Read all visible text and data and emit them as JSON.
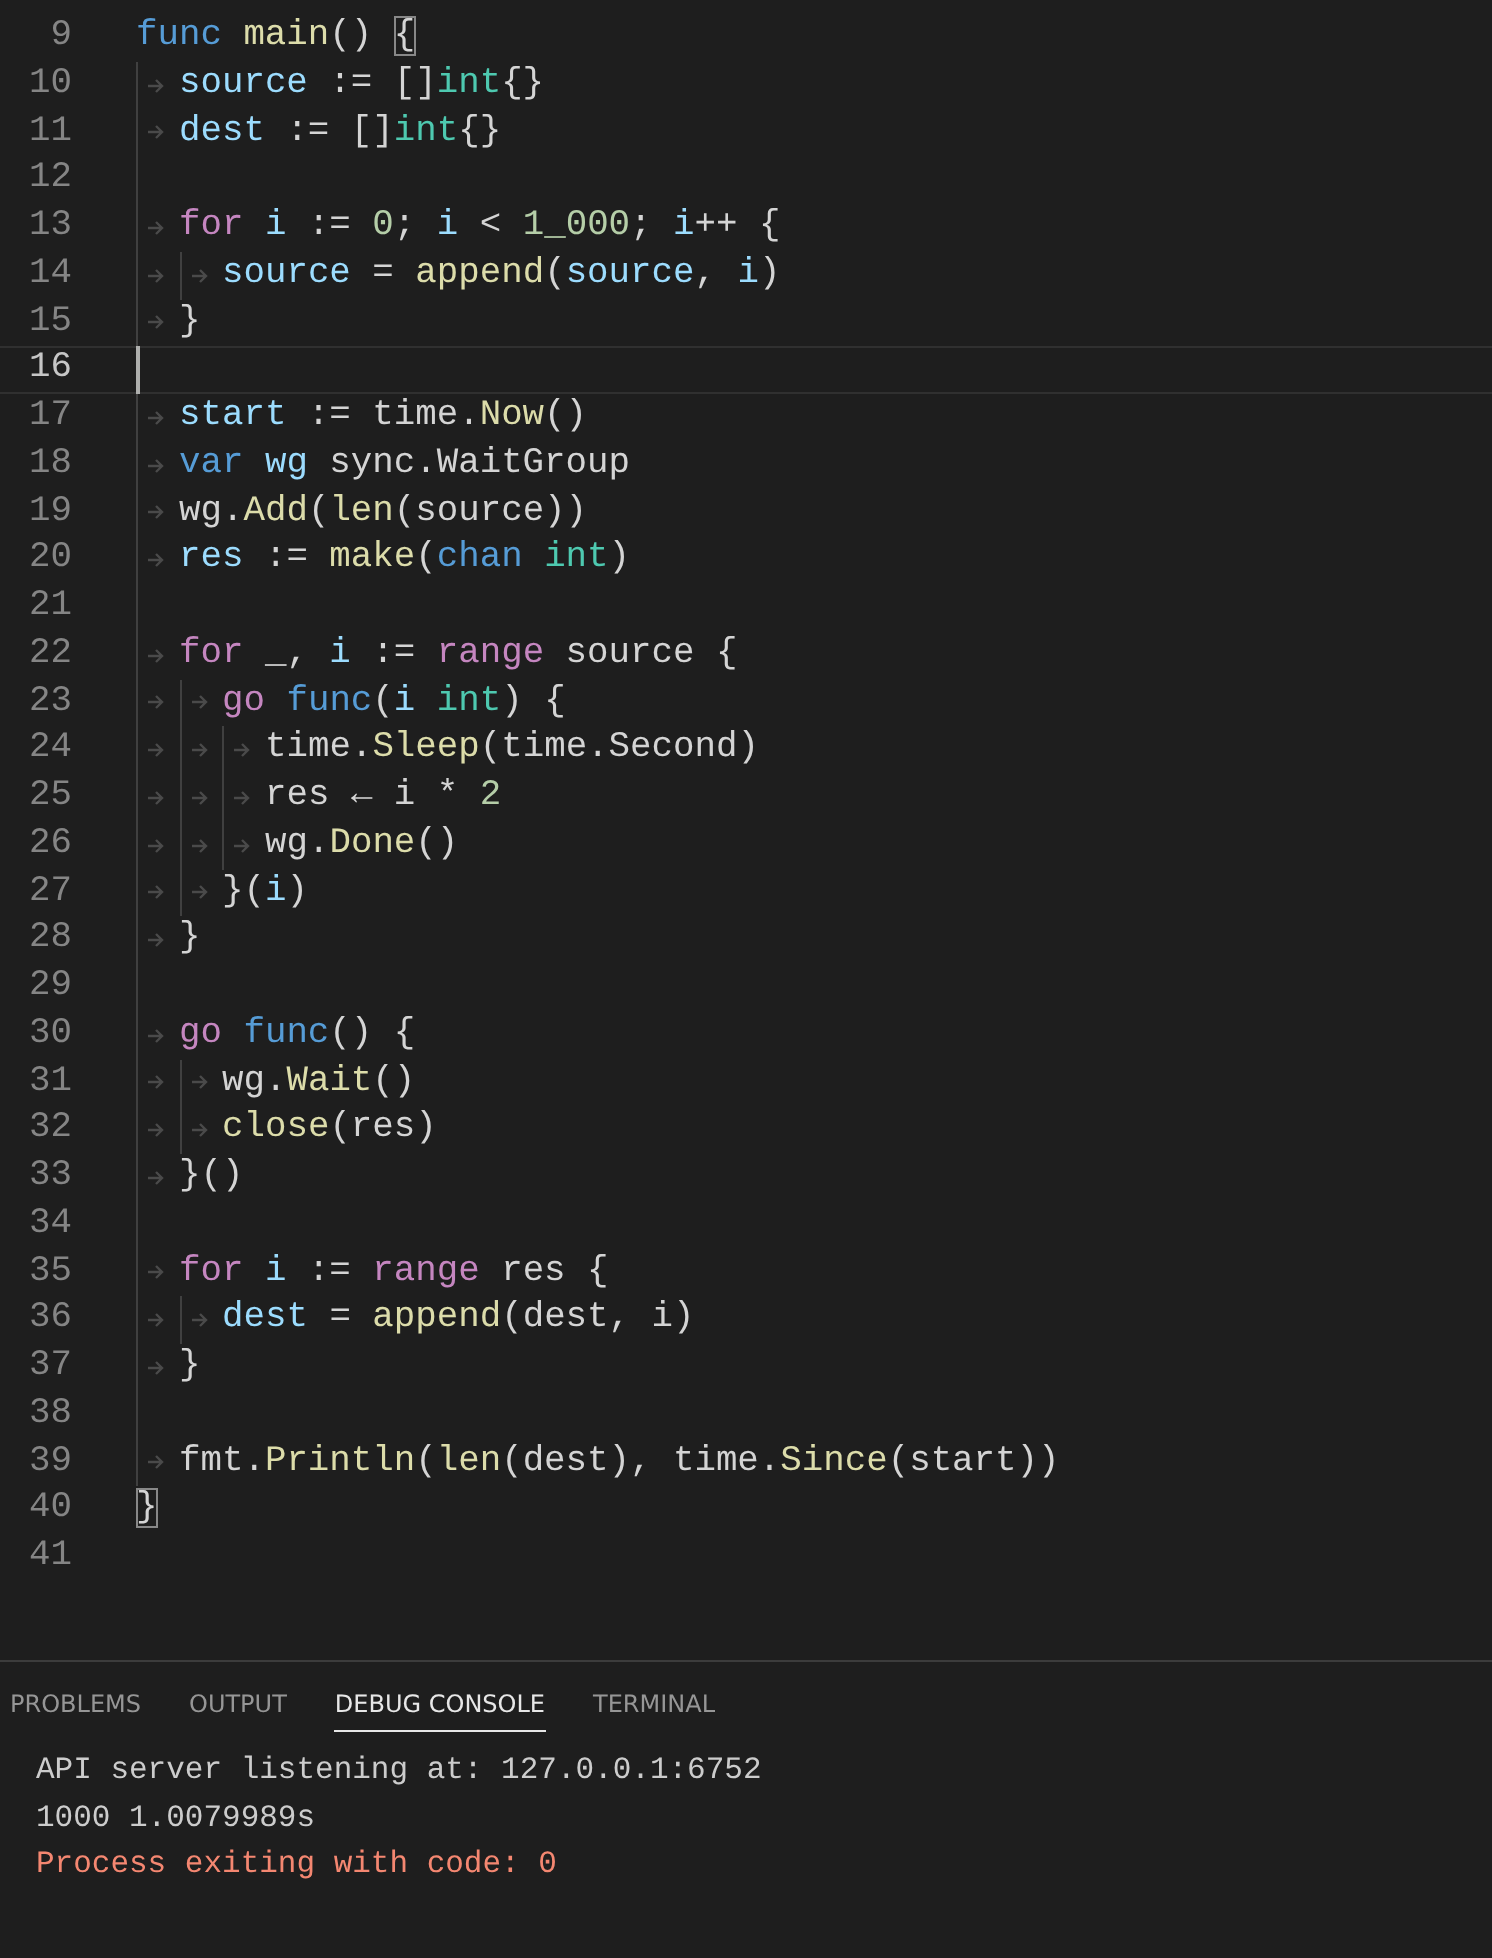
{
  "editor": {
    "lines": [
      {
        "number": "9",
        "current": false,
        "tokens": [
          {
            "text": "func ",
            "kind": "keyword"
          },
          {
            "text": "main",
            "kind": "function"
          },
          {
            "text": "() ",
            "kind": "plain"
          },
          {
            "text": "{",
            "kind": "bracket-match"
          }
        ]
      },
      {
        "number": "10",
        "current": false,
        "indent": [
          {
            "kind": "tab"
          }
        ],
        "tokens": [
          {
            "text": "source",
            "kind": "variable"
          },
          {
            "text": " := []",
            "kind": "plain"
          },
          {
            "text": "int",
            "kind": "type"
          },
          {
            "text": "{}",
            "kind": "plain"
          }
        ]
      },
      {
        "number": "11",
        "current": false,
        "indent": [
          {
            "kind": "tab"
          }
        ],
        "tokens": [
          {
            "text": "dest",
            "kind": "variable"
          },
          {
            "text": " := []",
            "kind": "plain"
          },
          {
            "text": "int",
            "kind": "type"
          },
          {
            "text": "{}",
            "kind": "plain"
          }
        ]
      },
      {
        "number": "12",
        "current": false,
        "indent": [
          {
            "kind": "guide"
          }
        ]
      },
      {
        "number": "13",
        "current": false,
        "indent": [
          {
            "kind": "tab"
          }
        ],
        "tokens": [
          {
            "text": "for ",
            "kind": "control"
          },
          {
            "text": "i",
            "kind": "variable"
          },
          {
            "text": " := ",
            "kind": "plain"
          },
          {
            "text": "0",
            "kind": "number"
          },
          {
            "text": "; ",
            "kind": "plain"
          },
          {
            "text": "i",
            "kind": "variable"
          },
          {
            "text": " < ",
            "kind": "plain"
          },
          {
            "text": "1_000",
            "kind": "number"
          },
          {
            "text": "; ",
            "kind": "plain"
          },
          {
            "text": "i",
            "kind": "variable"
          },
          {
            "text": "++ {",
            "kind": "plain"
          }
        ]
      },
      {
        "number": "14",
        "current": false,
        "indent": [
          {
            "kind": "tab"
          },
          {
            "kind": "tab"
          }
        ],
        "tokens": [
          {
            "text": "source",
            "kind": "variable"
          },
          {
            "text": " = ",
            "kind": "plain"
          },
          {
            "text": "append",
            "kind": "function"
          },
          {
            "text": "(",
            "kind": "plain"
          },
          {
            "text": "source",
            "kind": "variable"
          },
          {
            "text": ", ",
            "kind": "plain"
          },
          {
            "text": "i",
            "kind": "variable"
          },
          {
            "text": ")",
            "kind": "plain"
          }
        ]
      },
      {
        "number": "15",
        "current": false,
        "indent": [
          {
            "kind": "tab"
          }
        ],
        "tokens": [
          {
            "text": "}",
            "kind": "plain"
          }
        ]
      },
      {
        "number": "16",
        "current": true,
        "indent": [
          {
            "kind": "guide"
          }
        ]
      },
      {
        "number": "17",
        "current": false,
        "indent": [
          {
            "kind": "tab"
          }
        ],
        "tokens": [
          {
            "text": "start",
            "kind": "variable"
          },
          {
            "text": " := time.",
            "kind": "plain"
          },
          {
            "text": "Now",
            "kind": "function"
          },
          {
            "text": "()",
            "kind": "plain"
          }
        ]
      },
      {
        "number": "18",
        "current": false,
        "indent": [
          {
            "kind": "tab"
          }
        ],
        "tokens": [
          {
            "text": "var ",
            "kind": "keyword"
          },
          {
            "text": "wg",
            "kind": "variable"
          },
          {
            "text": " sync.WaitGroup",
            "kind": "plain"
          }
        ]
      },
      {
        "number": "19",
        "current": false,
        "indent": [
          {
            "kind": "tab"
          }
        ],
        "tokens": [
          {
            "text": "wg.",
            "kind": "plain"
          },
          {
            "text": "Add",
            "kind": "function"
          },
          {
            "text": "(",
            "kind": "plain"
          },
          {
            "text": "len",
            "kind": "function"
          },
          {
            "text": "(source))",
            "kind": "plain"
          }
        ]
      },
      {
        "number": "20",
        "current": false,
        "indent": [
          {
            "kind": "tab"
          }
        ],
        "tokens": [
          {
            "text": "res",
            "kind": "variable"
          },
          {
            "text": " := ",
            "kind": "plain"
          },
          {
            "text": "make",
            "kind": "function"
          },
          {
            "text": "(",
            "kind": "plain"
          },
          {
            "text": "chan ",
            "kind": "keyword"
          },
          {
            "text": "int",
            "kind": "type"
          },
          {
            "text": ")",
            "kind": "plain"
          }
        ]
      },
      {
        "number": "21",
        "current": false,
        "indent": [
          {
            "kind": "guide"
          }
        ]
      },
      {
        "number": "22",
        "current": false,
        "indent": [
          {
            "kind": "tab"
          }
        ],
        "tokens": [
          {
            "text": "for",
            "kind": "control"
          },
          {
            "text": " _, ",
            "kind": "plain"
          },
          {
            "text": "i",
            "kind": "variable"
          },
          {
            "text": " := ",
            "kind": "plain"
          },
          {
            "text": "range",
            "kind": "control"
          },
          {
            "text": " source {",
            "kind": "plain"
          }
        ]
      },
      {
        "number": "23",
        "current": false,
        "indent": [
          {
            "kind": "tab"
          },
          {
            "kind": "tab"
          }
        ],
        "tokens": [
          {
            "text": "go ",
            "kind": "control"
          },
          {
            "text": "func",
            "kind": "keyword"
          },
          {
            "text": "(",
            "kind": "plain"
          },
          {
            "text": "i ",
            "kind": "variable"
          },
          {
            "text": "int",
            "kind": "type"
          },
          {
            "text": ") {",
            "kind": "plain"
          }
        ]
      },
      {
        "number": "24",
        "current": false,
        "indent": [
          {
            "kind": "tab"
          },
          {
            "kind": "tab"
          },
          {
            "kind": "tab"
          }
        ],
        "tokens": [
          {
            "text": "time.",
            "kind": "plain"
          },
          {
            "text": "Sleep",
            "kind": "function"
          },
          {
            "text": "(time.Second)",
            "kind": "plain"
          }
        ]
      },
      {
        "number": "25",
        "current": false,
        "indent": [
          {
            "kind": "tab"
          },
          {
            "kind": "tab"
          },
          {
            "kind": "tab"
          }
        ],
        "tokens": [
          {
            "text": "res ← i * ",
            "kind": "plain"
          },
          {
            "text": "2",
            "kind": "number"
          }
        ]
      },
      {
        "number": "26",
        "current": false,
        "indent": [
          {
            "kind": "tab"
          },
          {
            "kind": "tab"
          },
          {
            "kind": "tab"
          }
        ],
        "tokens": [
          {
            "text": "wg.",
            "kind": "plain"
          },
          {
            "text": "Done",
            "kind": "function"
          },
          {
            "text": "()",
            "kind": "plain"
          }
        ]
      },
      {
        "number": "27",
        "current": false,
        "indent": [
          {
            "kind": "tab"
          },
          {
            "kind": "tab"
          }
        ],
        "tokens": [
          {
            "text": "}(",
            "kind": "plain"
          },
          {
            "text": "i",
            "kind": "variable"
          },
          {
            "text": ")",
            "kind": "plain"
          }
        ]
      },
      {
        "number": "28",
        "current": false,
        "indent": [
          {
            "kind": "tab"
          }
        ],
        "tokens": [
          {
            "text": "}",
            "kind": "plain"
          }
        ]
      },
      {
        "number": "29",
        "current": false,
        "indent": [
          {
            "kind": "guide"
          }
        ]
      },
      {
        "number": "30",
        "current": false,
        "indent": [
          {
            "kind": "tab"
          }
        ],
        "tokens": [
          {
            "text": "go ",
            "kind": "control"
          },
          {
            "text": "func",
            "kind": "keyword"
          },
          {
            "text": "() {",
            "kind": "plain"
          }
        ]
      },
      {
        "number": "31",
        "current": false,
        "indent": [
          {
            "kind": "tab"
          },
          {
            "kind": "tab"
          }
        ],
        "tokens": [
          {
            "text": "wg.",
            "kind": "plain"
          },
          {
            "text": "Wait",
            "kind": "function"
          },
          {
            "text": "()",
            "kind": "plain"
          }
        ]
      },
      {
        "number": "32",
        "current": false,
        "indent": [
          {
            "kind": "tab"
          },
          {
            "kind": "tab"
          }
        ],
        "tokens": [
          {
            "text": "close",
            "kind": "function"
          },
          {
            "text": "(res)",
            "kind": "plain"
          }
        ]
      },
      {
        "number": "33",
        "current": false,
        "indent": [
          {
            "kind": "tab"
          }
        ],
        "tokens": [
          {
            "text": "}()",
            "kind": "plain"
          }
        ]
      },
      {
        "number": "34",
        "current": false,
        "indent": [
          {
            "kind": "guide"
          }
        ]
      },
      {
        "number": "35",
        "current": false,
        "indent": [
          {
            "kind": "tab"
          }
        ],
        "tokens": [
          {
            "text": "for ",
            "kind": "control"
          },
          {
            "text": "i",
            "kind": "variable"
          },
          {
            "text": " := ",
            "kind": "plain"
          },
          {
            "text": "range",
            "kind": "control"
          },
          {
            "text": " res {",
            "kind": "plain"
          }
        ]
      },
      {
        "number": "36",
        "current": false,
        "indent": [
          {
            "kind": "tab"
          },
          {
            "kind": "tab"
          }
        ],
        "tokens": [
          {
            "text": "dest",
            "kind": "variable"
          },
          {
            "text": " = ",
            "kind": "plain"
          },
          {
            "text": "append",
            "kind": "function"
          },
          {
            "text": "(dest, i)",
            "kind": "plain"
          }
        ]
      },
      {
        "number": "37",
        "current": false,
        "indent": [
          {
            "kind": "tab"
          }
        ],
        "tokens": [
          {
            "text": "}",
            "kind": "plain"
          }
        ]
      },
      {
        "number": "38",
        "current": false,
        "indent": [
          {
            "kind": "guide"
          }
        ]
      },
      {
        "number": "39",
        "current": false,
        "indent": [
          {
            "kind": "tab"
          }
        ],
        "tokens": [
          {
            "text": "fmt.",
            "kind": "plain"
          },
          {
            "text": "Println",
            "kind": "function"
          },
          {
            "text": "(",
            "kind": "plain"
          },
          {
            "text": "len",
            "kind": "function"
          },
          {
            "text": "(dest), time.",
            "kind": "plain"
          },
          {
            "text": "Since",
            "kind": "function"
          },
          {
            "text": "(start))",
            "kind": "plain"
          }
        ]
      },
      {
        "number": "40",
        "current": false,
        "tokens": [
          {
            "text": "}",
            "kind": "bracket-match"
          }
        ]
      },
      {
        "number": "41",
        "current": false
      }
    ]
  },
  "panel": {
    "tabs": [
      {
        "label": "PROBLEMS",
        "selected": false
      },
      {
        "label": "OUTPUT",
        "selected": false
      },
      {
        "label": "DEBUG CONSOLE",
        "selected": true
      },
      {
        "label": "TERMINAL",
        "selected": false
      }
    ],
    "console": [
      {
        "text": "API server listening at: 127.0.0.1:6752",
        "kind": "info"
      },
      {
        "text": "1000 1.0079989s",
        "kind": "info"
      },
      {
        "text": "Process exiting with code: 0",
        "kind": "error"
      }
    ]
  }
}
